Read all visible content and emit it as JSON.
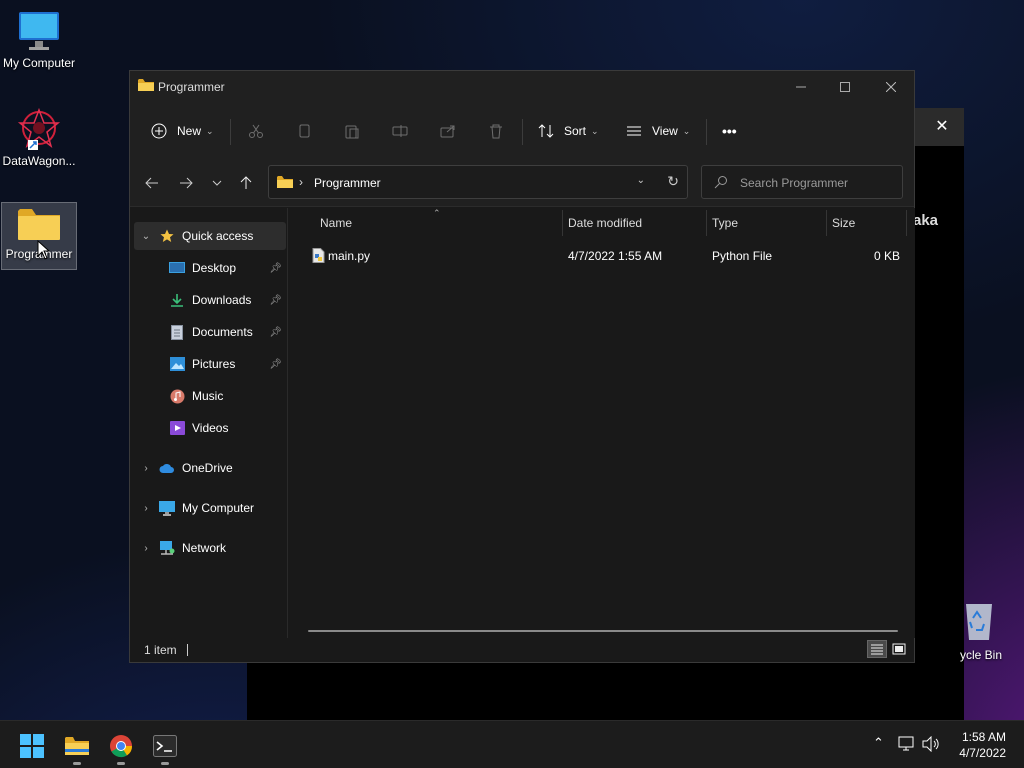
{
  "desktop": {
    "icons": [
      {
        "label": "My Computer",
        "icon": "monitor-icon"
      },
      {
        "label": "DataWagon...",
        "icon": "datawagon-icon"
      },
      {
        "label": "Programmer",
        "icon": "folder-icon"
      }
    ],
    "recycle_bin_label": "ycle Bin",
    "background_window_text": "aka"
  },
  "explorer": {
    "title": "Programmer",
    "toolbar": {
      "new_label": "New",
      "sort_label": "Sort",
      "view_label": "View",
      "more_label": "•••"
    },
    "address": {
      "crumb": "Programmer",
      "search_placeholder": "Search Programmer"
    },
    "nav": {
      "quick_access": "Quick access",
      "items": [
        {
          "label": "Desktop",
          "pinned": true
        },
        {
          "label": "Downloads",
          "pinned": true
        },
        {
          "label": "Documents",
          "pinned": true
        },
        {
          "label": "Pictures",
          "pinned": true
        },
        {
          "label": "Music",
          "pinned": false
        },
        {
          "label": "Videos",
          "pinned": false
        }
      ],
      "roots": [
        {
          "label": "OneDrive"
        },
        {
          "label": "My Computer"
        },
        {
          "label": "Network"
        }
      ]
    },
    "columns": {
      "name": "Name",
      "date": "Date modified",
      "type": "Type",
      "size": "Size"
    },
    "files": [
      {
        "name": "main.py",
        "date": "4/7/2022 1:55 AM",
        "type": "Python File",
        "size": "0 KB"
      }
    ],
    "status": {
      "count": "1 item"
    }
  },
  "taskbar": {
    "time": "1:58 AM",
    "date": "4/7/2022"
  },
  "colors": {
    "folder": "#f3c14b",
    "accent": "#4cc2ff"
  }
}
